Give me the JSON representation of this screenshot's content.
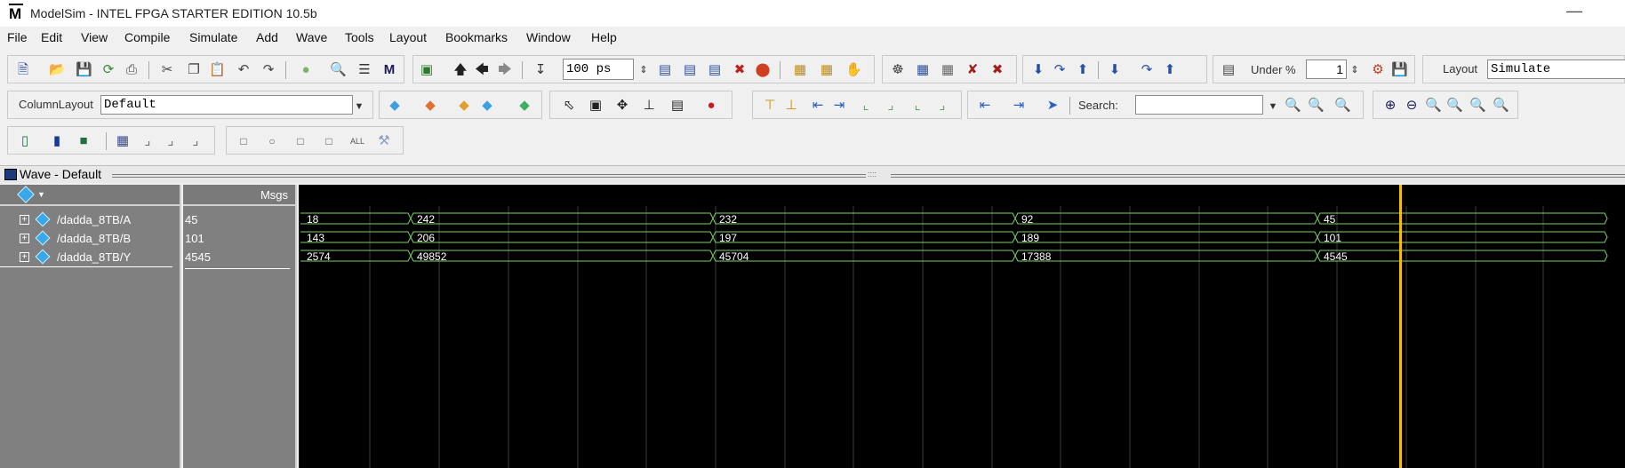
{
  "window": {
    "title": "ModelSim - INTEL FPGA STARTER EDITION 10.5b",
    "icon": "M"
  },
  "menu": [
    "File",
    "Edit",
    "View",
    "Compile",
    "Simulate",
    "Add",
    "Wave",
    "Tools",
    "Layout",
    "Bookmarks",
    "Window",
    "Help"
  ],
  "toolbar": {
    "run_length": "100 ps",
    "under_label": "Under %",
    "under_value": "1",
    "layout_label": "Layout",
    "layout_value": "Simulate",
    "column_layout_label": "ColumnLayout",
    "column_layout_value": "Default",
    "search_label": "Search:",
    "search_value": ""
  },
  "wave_panel": {
    "title": "Wave - Default",
    "msgs_header": "Msgs",
    "signals": [
      {
        "name": "/dadda_8TB/A",
        "value": "45",
        "segments": [
          "18",
          "242",
          "232",
          "92",
          "45"
        ]
      },
      {
        "name": "/dadda_8TB/B",
        "value": "101",
        "segments": [
          "143",
          "206",
          "197",
          "189",
          "101"
        ]
      },
      {
        "name": "/dadda_8TB/Y",
        "value": "4545",
        "segments": [
          "2574",
          "49852",
          "45704",
          "17388",
          "4545"
        ]
      }
    ]
  },
  "colors": {
    "wave_bg": "#000000",
    "wave_trace": "#7cd06a",
    "cursor": "#f0c000",
    "grid": "#3c3c3c",
    "panel_gray": "#808080"
  }
}
